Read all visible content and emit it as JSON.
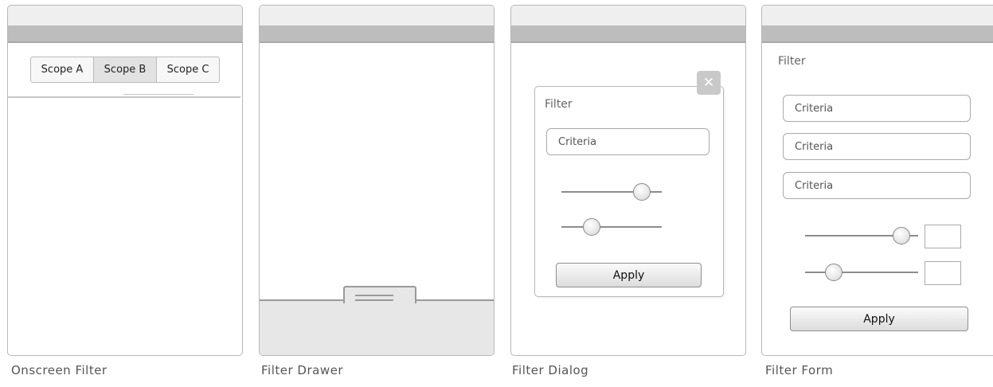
{
  "panels": [
    {
      "caption": "Onscreen Filter",
      "scopes": [
        "Scope A",
        "Scope B",
        "Scope C"
      ],
      "active_scope": "Scope B"
    },
    {
      "caption": "Filter Drawer"
    },
    {
      "caption": "Filter Dialog",
      "title": "Filter",
      "fields": [
        "Criteria"
      ],
      "apply_label": "Apply",
      "close_icon": "close-icon",
      "sliders": [
        0.8,
        0.3
      ]
    },
    {
      "caption": "Filter Form",
      "title": "Filter",
      "fields": [
        "Criteria",
        "Criteria",
        "Criteria"
      ],
      "apply_label": "Apply",
      "sliders": [
        0.85,
        0.25
      ]
    }
  ]
}
